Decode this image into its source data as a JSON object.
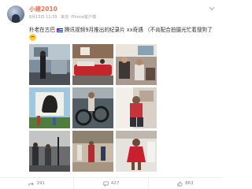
{
  "post": {
    "username": "小建2010",
    "date": "8月15日 11:39",
    "source_label": "来自",
    "client": "iPhone客户端",
    "text": {
      "part1": "朴老在古巴",
      "part2": "腾讯视频9月推出的纪录片 xx奇遇 （不肯配合拍摄光忙着搜狗了",
      "flag_icon": "cuba-flag-icon",
      "emoji_icon": "sweat-smile-emoji-icon"
    },
    "images": [
      {
        "name": "photo-old-car-man"
      },
      {
        "name": "photo-red-boat"
      },
      {
        "name": "photo-room-group"
      },
      {
        "name": "photo-che-mural"
      },
      {
        "name": "photo-bikes-street"
      },
      {
        "name": "photo-woman-sitting"
      },
      {
        "name": "photo-street-crew"
      },
      {
        "name": "photo-courtyard-dance"
      },
      {
        "name": "photo-dancer-red"
      }
    ],
    "actions": {
      "share_count": "191",
      "comment_count": "427",
      "like_count": "863"
    }
  },
  "colors": {
    "username": "#eb7350",
    "meta": "#a0a0a0",
    "action_text": "#808080"
  }
}
